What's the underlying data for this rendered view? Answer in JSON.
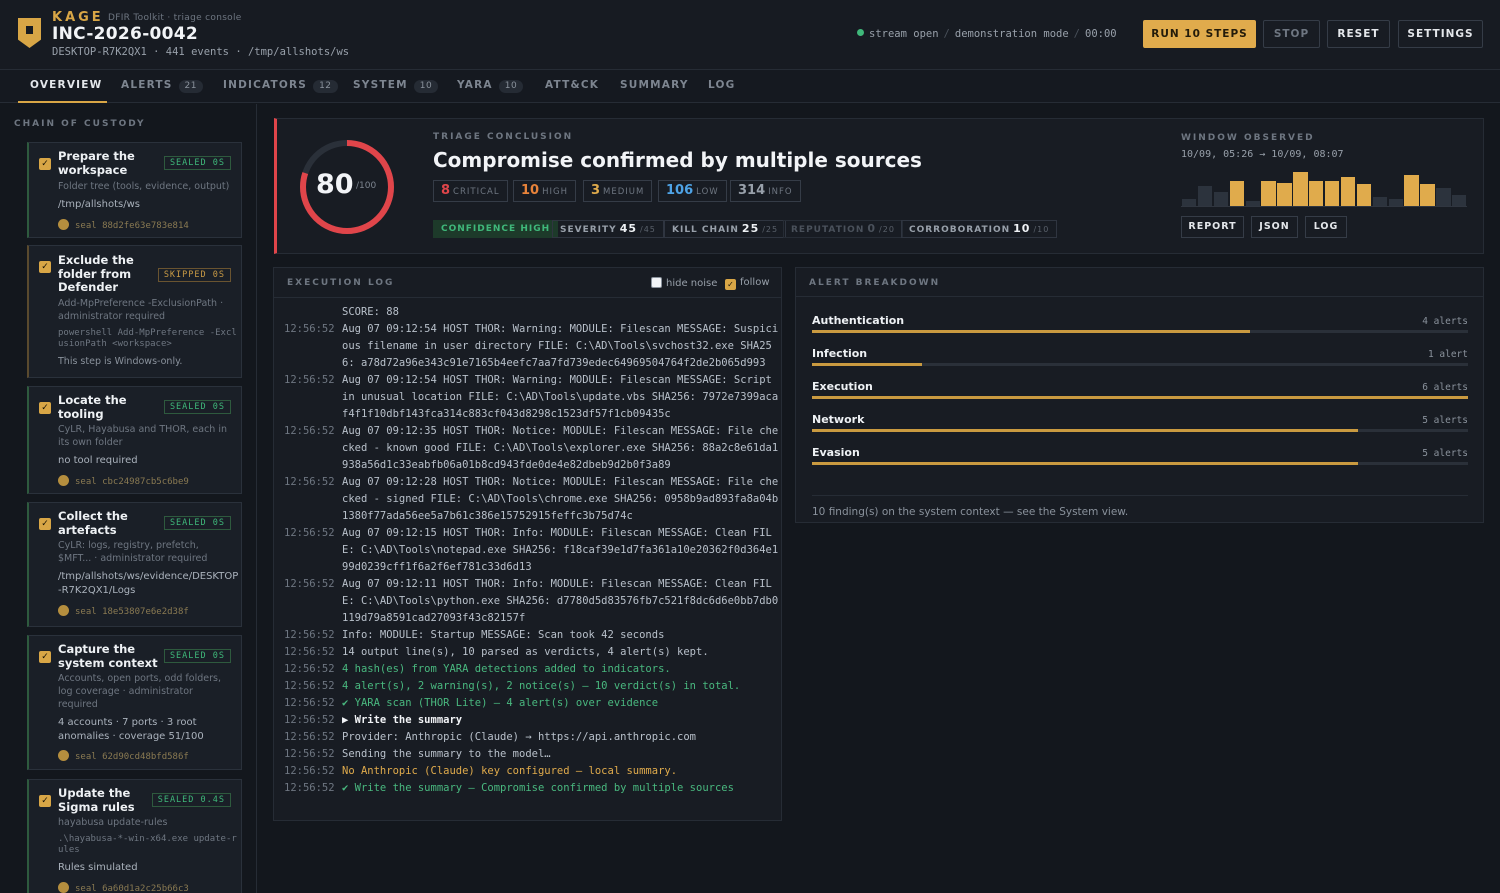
{
  "app": {
    "brand": "KAGE",
    "subtitle": "DFIR Toolkit · triage console",
    "incident": "INC-2026-0042",
    "host_line": "DESKTOP-R7K2QX1 · 441 events · /tmp/allshots/ws",
    "stream": "stream open",
    "mode": "demonstration mode",
    "timer": "00:00",
    "stream_color": "#3fb87a"
  },
  "toolbar": {
    "run_label": "RUN 10 STEPS",
    "stop_label": "STOP",
    "reset_label": "RESET",
    "settings_label": "SETTINGS"
  },
  "tabs": [
    {
      "label": "OVERVIEW",
      "count": ""
    },
    {
      "label": "ALERTS",
      "count": "21"
    },
    {
      "label": "INDICATORS",
      "count": "12"
    },
    {
      "label": "SYSTEM",
      "count": "10"
    },
    {
      "label": "YARA",
      "count": "10"
    },
    {
      "label": "ATT&CK",
      "count": ""
    },
    {
      "label": "SUMMARY",
      "count": ""
    },
    {
      "label": "LOG",
      "count": ""
    }
  ],
  "custody": {
    "title": "CHAIN OF CUSTODY",
    "steps": [
      {
        "title": "Prepare the workspace",
        "status": "SEALED 0S",
        "desc": "Folder tree (tools, evidence, output)",
        "value": "/tmp/allshots/ws",
        "seal": "seal 88d2fe63e783e814"
      },
      {
        "title": "Exclude the folder from Defender",
        "status": "SKIPPED 0S",
        "desc": "Add-MpPreference -ExclusionPath · administrator required",
        "cmd": "powershell Add-MpPreference -ExclusionPath <workspace>",
        "value": "This step is Windows-only."
      },
      {
        "title": "Locate the tooling",
        "status": "SEALED 0S",
        "desc": "CyLR, Hayabusa and THOR, each in its own folder",
        "value": "no tool required",
        "seal": "seal cbc24987cb5c6be9"
      },
      {
        "title": "Collect the artefacts",
        "status": "SEALED 0S",
        "desc": "CyLR: logs, registry, prefetch, $MFT... · administrator required",
        "value": "/tmp/allshots/ws/evidence/DESKTOP-R7K2QX1/Logs",
        "seal": "seal 18e53807e6e2d38f"
      },
      {
        "title": "Capture the system context",
        "status": "SEALED 0S",
        "desc": "Accounts, open ports, odd folders, log coverage · administrator required",
        "value": "4 accounts · 7 ports · 3 root anomalies · coverage 51/100",
        "seal": "seal 62d90cd48bfd586f"
      },
      {
        "title": "Update the Sigma rules",
        "status": "SEALED 0.4S",
        "desc": "hayabusa update-rules",
        "cmd": ".\\hayabusa-*-win-x64.exe update-rules",
        "value": "Rules simulated",
        "seal": "seal 6a60d1a2c25b66c3"
      }
    ]
  },
  "conclusion": {
    "label": "TRIAGE CONCLUSION",
    "title": "Compromise confirmed by multiple sources",
    "score": 80,
    "score_max": "/100",
    "score_fraction": 0.8,
    "accent": "#e0454a",
    "severities": [
      {
        "n": "8",
        "label": "CRITICAL",
        "color": "#e0454a"
      },
      {
        "n": "10",
        "label": "HIGH",
        "color": "#e8833a"
      },
      {
        "n": "3",
        "label": "MEDIUM",
        "color": "#e0ab4c"
      },
      {
        "n": "106",
        "label": "LOW",
        "color": "#4ea3e6"
      },
      {
        "n": "314",
        "label": "INFO",
        "color": "#98a0aa"
      }
    ],
    "confidence": "CONFIDENCE HIGH",
    "metrics": [
      {
        "label": "SEVERITY",
        "value": "45",
        "max": "/45"
      },
      {
        "label": "KILL CHAIN",
        "value": "25",
        "max": "/25"
      },
      {
        "label": "REPUTATION",
        "value": "0",
        "max": "/20"
      },
      {
        "label": "CORROBORATION",
        "value": "10",
        "max": "/10"
      }
    ],
    "window_label": "WINDOW OBSERVED",
    "window_range": "10/09, 05:26 → 10/09, 08:07",
    "window_activity": [
      0.2,
      0.55,
      0.4,
      0.7,
      0.15,
      0.7,
      0.65,
      0.95,
      0.7,
      0.7,
      0.8,
      0.6,
      0.25,
      0.2,
      0.85,
      0.6,
      0.5,
      0.3
    ],
    "window_active": [
      false,
      false,
      false,
      true,
      false,
      true,
      true,
      true,
      true,
      true,
      true,
      true,
      false,
      false,
      true,
      true,
      false,
      false
    ],
    "report_label": "REPORT",
    "json_label": "JSON",
    "log_label": "LOG"
  },
  "exec_log": {
    "title": "EXECUTION LOG",
    "hide_noise": "hide noise",
    "follow": "follow",
    "lines": [
      {
        "t": "",
        "m": "SCORE: 88",
        "k": ""
      },
      {
        "t": "12:56:52",
        "m": "Aug 07 09:12:54 HOST THOR: Warning: MODULE: Filescan MESSAGE: Suspicious filename in user directory FILE: C:\\AD\\Tools\\svchost32.exe SHA256: a78d72a96e343c91e7165b4eefc7aa7fd739edec64969504764f2de2b065d993",
        "k": ""
      },
      {
        "t": "12:56:52",
        "m": "Aug 07 09:12:54 HOST THOR: Warning: MODULE: Filescan MESSAGE: Script in unusual location FILE: C:\\AD\\Tools\\update.vbs SHA256: 7972e7399acaf4f1f10dbf143fca314c883cf043d8298c1523df57f1cb09435c",
        "k": ""
      },
      {
        "t": "12:56:52",
        "m": "Aug 07 09:12:35 HOST THOR: Notice: MODULE: Filescan MESSAGE: File checked - known good FILE: C:\\AD\\Tools\\explorer.exe SHA256: 88a2c8e61da1938a56d1c33eabfb06a01b8cd943fde0de4e82dbeb9d2b0f3a89",
        "k": ""
      },
      {
        "t": "12:56:52",
        "m": "Aug 07 09:12:28 HOST THOR: Notice: MODULE: Filescan MESSAGE: File checked - signed FILE: C:\\AD\\Tools\\chrome.exe SHA256: 0958b9ad893fa8a04b1380f77ada56ee5a7b61c386e15752915feffc3b75d74c",
        "k": ""
      },
      {
        "t": "12:56:52",
        "m": "Aug 07 09:12:15 HOST THOR: Info: MODULE: Filescan MESSAGE: Clean FILE: C:\\AD\\Tools\\notepad.exe SHA256: f18caf39e1d7fa361a10e20362f0d364e199d0239cff1f6a2f6ef781c33d6d13",
        "k": ""
      },
      {
        "t": "12:56:52",
        "m": "Aug 07 09:12:11 HOST THOR: Info: MODULE: Filescan MESSAGE: Clean FILE: C:\\AD\\Tools\\python.exe SHA256: d7780d5d83576fb7c521f8dc6d6e0bb7db0119d79a8591cad27093f43c82157f",
        "k": ""
      },
      {
        "t": "12:56:52",
        "m": "Info: MODULE: Startup MESSAGE: Scan took 42 seconds",
        "k": ""
      },
      {
        "t": "12:56:52",
        "m": "14 output line(s), 10 parsed as verdicts, 4 alert(s) kept.",
        "k": ""
      },
      {
        "t": "12:56:52",
        "m": "4 hash(es) from YARA detections added to indicators.",
        "k": "ok"
      },
      {
        "t": "12:56:52",
        "m": "4 alert(s), 2 warning(s), 2 notice(s) — 10 verdict(s) in total.",
        "k": "ok"
      },
      {
        "t": "12:56:52",
        "m": "✔ YARA scan (THOR Lite) — 4 alert(s) over evidence",
        "k": "ok"
      },
      {
        "t": "12:56:52",
        "m": "▶ Write the summary",
        "k": "bold"
      },
      {
        "t": "12:56:52",
        "m": "Provider: Anthropic (Claude) → https://api.anthropic.com",
        "k": ""
      },
      {
        "t": "12:56:52",
        "m": "Sending the summary to the model…",
        "k": ""
      },
      {
        "t": "12:56:52",
        "m": "No Anthropic (Claude) key configured — local summary.",
        "k": "warn"
      },
      {
        "t": "12:56:52",
        "m": "✔ Write the summary — Compromise confirmed by multiple sources",
        "k": "ok"
      }
    ]
  },
  "breakdown": {
    "title": "ALERT BREAKDOWN",
    "items": [
      {
        "name": "Authentication",
        "count": "4 alerts",
        "fraction": 0.667
      },
      {
        "name": "Infection",
        "count": "1 alert",
        "fraction": 0.167
      },
      {
        "name": "Execution",
        "count": "6 alerts",
        "fraction": 1.0
      },
      {
        "name": "Network",
        "count": "5 alerts",
        "fraction": 0.833
      },
      {
        "name": "Evasion",
        "count": "5 alerts",
        "fraction": 0.833
      }
    ],
    "footer": "10 finding(s) on the system context — see the System view."
  }
}
